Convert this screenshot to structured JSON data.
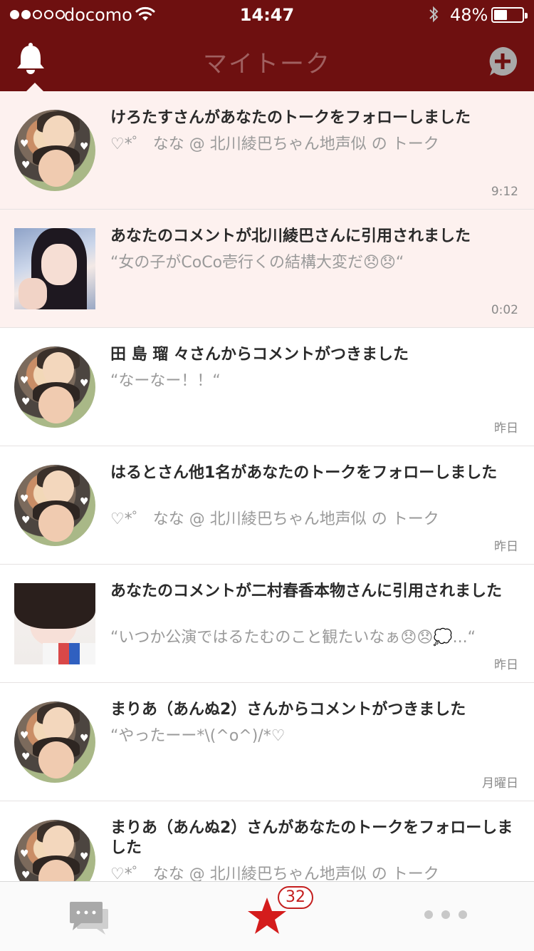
{
  "status_bar": {
    "carrier": "docomo",
    "time": "14:47",
    "battery_percent_text": "48%",
    "battery_level": 0.48,
    "signal_bars_filled": 2,
    "signal_bars_total": 5
  },
  "nav": {
    "title": "マイトーク",
    "left_icon": "bell-icon",
    "right_icon": "add-talk-icon",
    "background_color": "#6e1010"
  },
  "notifications": [
    {
      "title": "けろたすさんがあなたのトークをフォローしました",
      "body": "♡*゜ なな @ 北川綾巴ちゃん地声似 の トーク",
      "time": "9:12",
      "unread": true,
      "avatar": "round-avatar"
    },
    {
      "title": "あなたのコメントが北川綾巴さんに引用されました",
      "body": "“女の子がCoCo壱行くの結構大変だ😞😞“",
      "time": "0:02",
      "unread": true,
      "avatar": "photo-avatar"
    },
    {
      "title": "田 島 瑠 々さんからコメントがつきました",
      "body": "“なーなー！！“",
      "time": "昨日",
      "unread": false,
      "avatar": "round-avatar"
    },
    {
      "title": "はるとさん他1名があなたのトークをフォローしました",
      "body": "♡*゜ なな @ 北川綾巴ちゃん地声似 の トーク",
      "time": "昨日",
      "unread": false,
      "avatar": "round-avatar"
    },
    {
      "title": "あなたのコメントが二村春香本物さんに引用されました",
      "body": "“いつか公演ではるたむのこと観たいなぁ😞😞💭...“",
      "time": "昨日",
      "unread": false,
      "avatar": "photo-avatar"
    },
    {
      "title": "まりあ（あんぬ2）さんからコメントがつきました",
      "body": "“やったーー*\\(^o^)/*♡",
      "time": "月曜日",
      "unread": false,
      "avatar": "round-avatar"
    },
    {
      "title": "まりあ（あんぬ2）さんがあなたのトークをフォローしました",
      "body": "♡*゜ なな @ 北川綾巴ちゃん地声似 の トーク",
      "time": "",
      "unread": false,
      "avatar": "round-avatar"
    }
  ],
  "tab_bar": {
    "tabs": [
      {
        "name": "talks",
        "icon": "chat-bubbles-icon"
      },
      {
        "name": "favorites",
        "icon": "star-icon"
      },
      {
        "name": "more",
        "icon": "more-dots-icon"
      }
    ],
    "badge_count": "32",
    "accent_color": "#d41c1c"
  }
}
